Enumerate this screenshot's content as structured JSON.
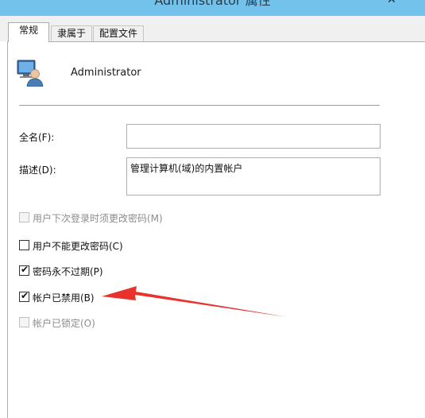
{
  "window": {
    "title": "Administrator 属性",
    "close_glyph": "✕"
  },
  "tabs": [
    {
      "label": "常规",
      "active": true
    },
    {
      "label": "隶属于",
      "active": false
    },
    {
      "label": "配置文件",
      "active": false
    }
  ],
  "user": {
    "name": "Administrator",
    "icon": "user-account-icon"
  },
  "form": {
    "fullname_label": "全名(F):",
    "fullname_value": "",
    "description_label": "描述(D):",
    "description_value": "管理计算机(域)的内置帐户"
  },
  "options": [
    {
      "label": "用户下次登录时须更改密码(M)",
      "checked": false,
      "enabled": false
    },
    {
      "label": "用户不能更改密码(C)",
      "checked": false,
      "enabled": true
    },
    {
      "label": "密码永不过期(P)",
      "checked": true,
      "enabled": true
    },
    {
      "label": "帐户已禁用(B)",
      "checked": true,
      "enabled": true
    },
    {
      "label": "帐户已锁定(O)",
      "checked": false,
      "enabled": false
    }
  ],
  "annotation": {
    "arrow_color": "#e8322d"
  }
}
